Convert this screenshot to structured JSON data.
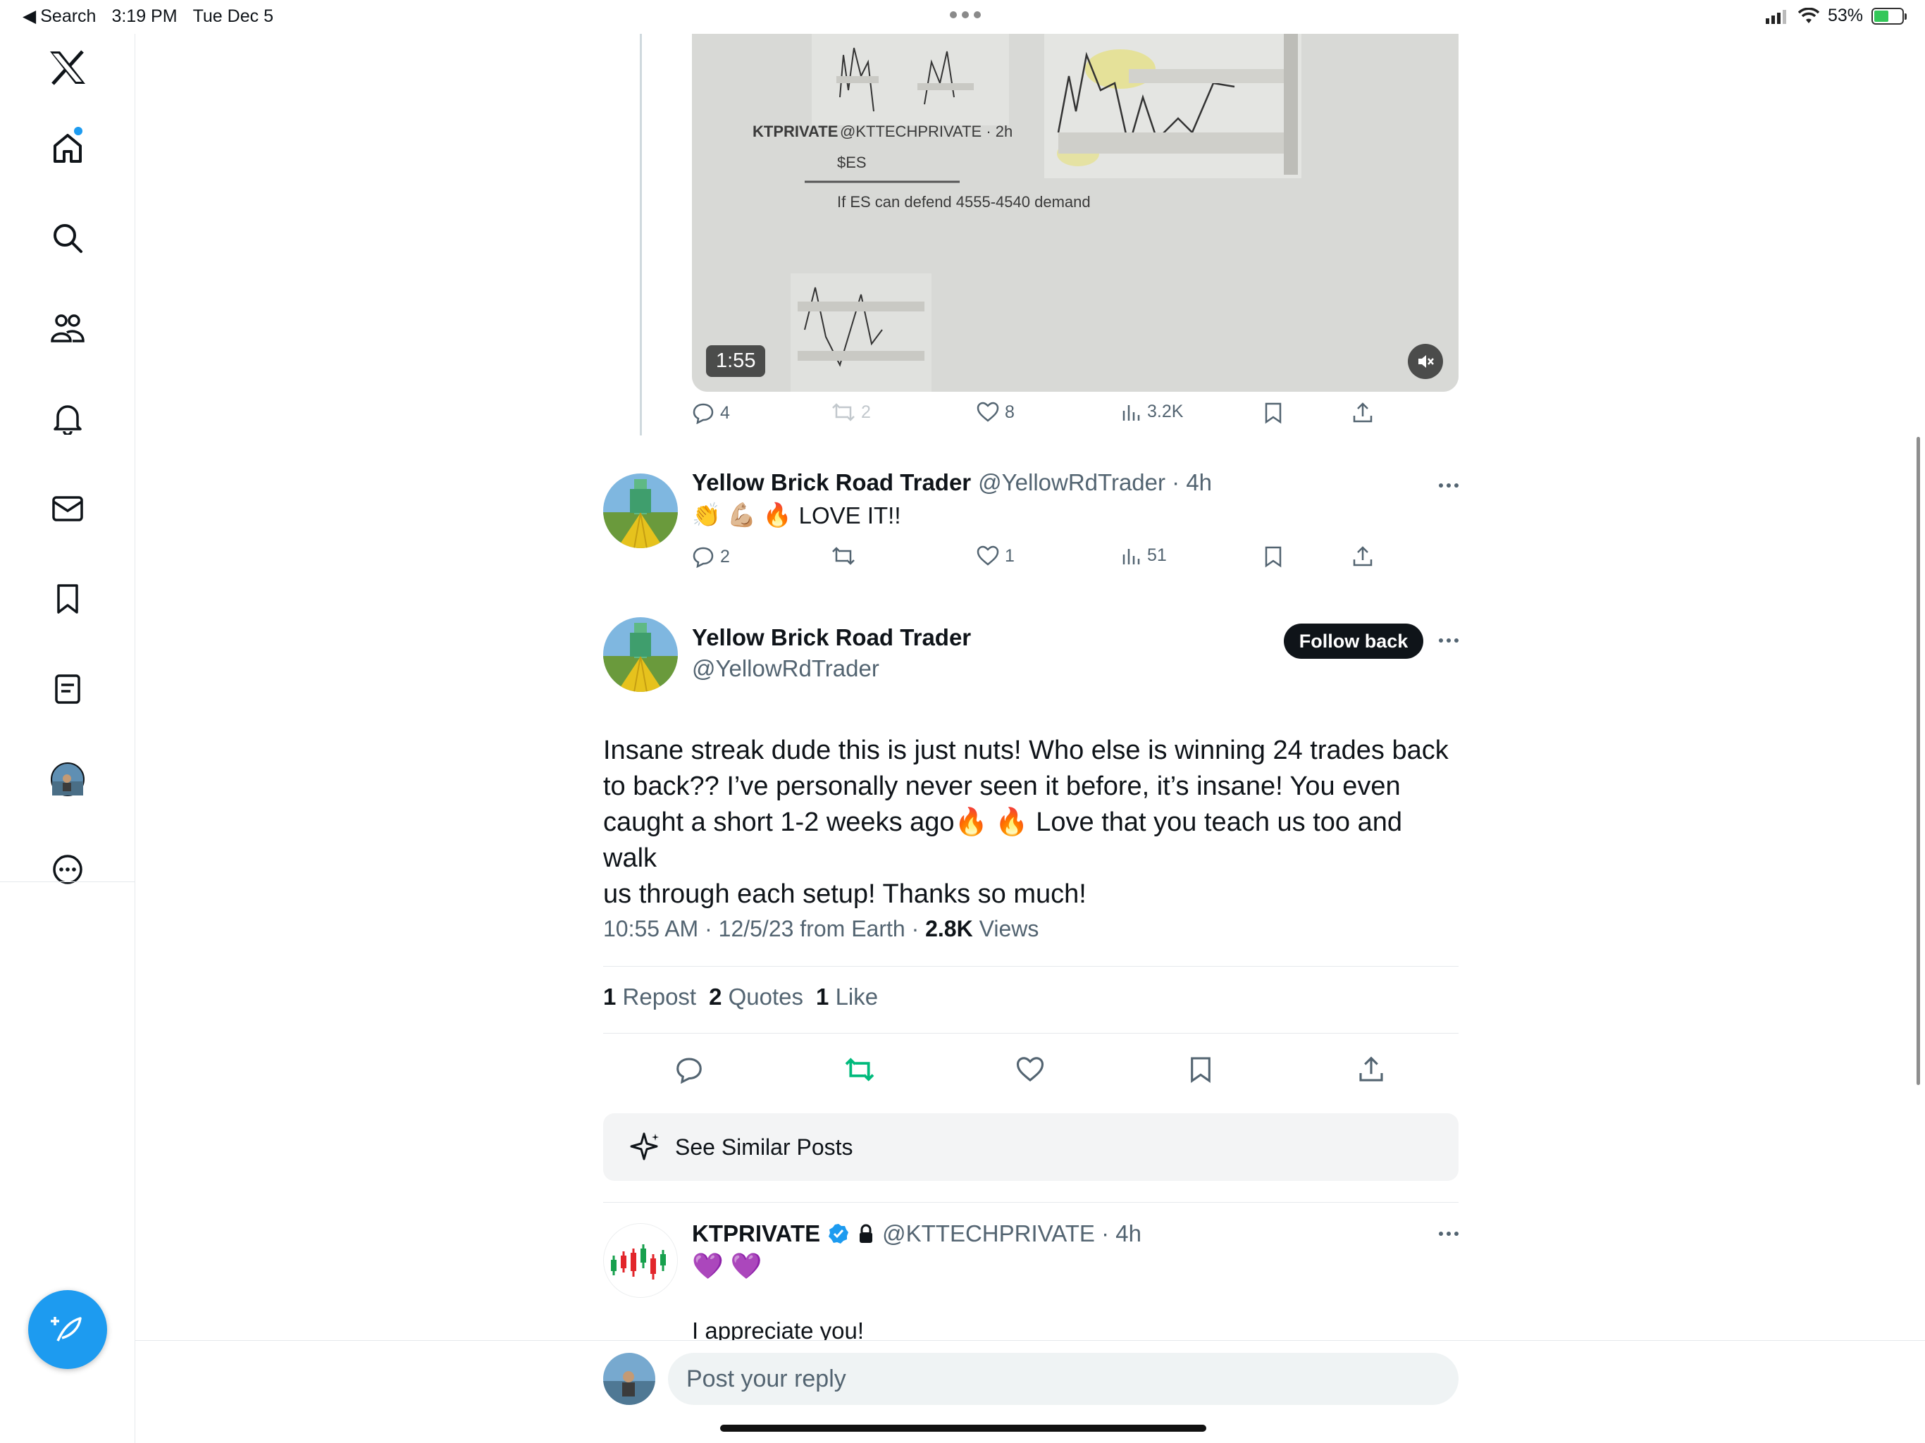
{
  "status_bar": {
    "back_label": "Search",
    "time": "3:19 PM",
    "date": "Tue Dec 5",
    "battery": "53%"
  },
  "video_post": {
    "duration": "1:55",
    "inner_account": "KTPRIVATE",
    "inner_handle": "@KTTECHPRIVATE · 2h",
    "inner_ticker": "$ES",
    "inner_text": "If ES can defend 4555-4540 demand",
    "replies": "4",
    "reposts": "2",
    "likes": "8",
    "views": "3.2K"
  },
  "reply_post": {
    "name": "Yellow Brick Road Trader",
    "handle_time": "@YellowRdTrader · 4h",
    "emojis": "👏 💪🏼 🔥",
    "text": "LOVE IT!!",
    "replies": "2",
    "likes": "1",
    "views": "51"
  },
  "main_post": {
    "name": "Yellow Brick Road Trader",
    "handle": "@YellowRdTrader",
    "follow_label": "Follow back",
    "text_1": "Insane streak dude this is just nuts! Who else is winning 24 trades back",
    "text_2": "to back?? I’ve personally never seen it before, it’s insane! You even",
    "text_3": "caught a short 1-2 weeks ago🔥 🔥 Love that you teach us too and walk",
    "text_4": "us through each setup! Thanks so much!",
    "timestamp": "10:55 AM · 12/5/23 from Earth · ",
    "views_count": "2.8K",
    "views_label": " Views",
    "repost_count": "1",
    "repost_label": "Repost",
    "quotes_count": "2",
    "quotes_label": "Quotes",
    "like_count": "1",
    "like_label": "Like"
  },
  "similar": {
    "label": "See Similar Posts"
  },
  "kt_reply": {
    "name": "KTPRIVATE",
    "handle_time": "@KTTECHPRIVATE · 4h",
    "emojis": "💜 💜",
    "text": "I appreciate you!"
  },
  "reply_input": {
    "placeholder": "Post your reply"
  },
  "colors": {
    "accent": "#1d9bf0",
    "repost_green": "#00ba7c",
    "text_primary": "#0f1419",
    "text_secondary": "#536471"
  }
}
